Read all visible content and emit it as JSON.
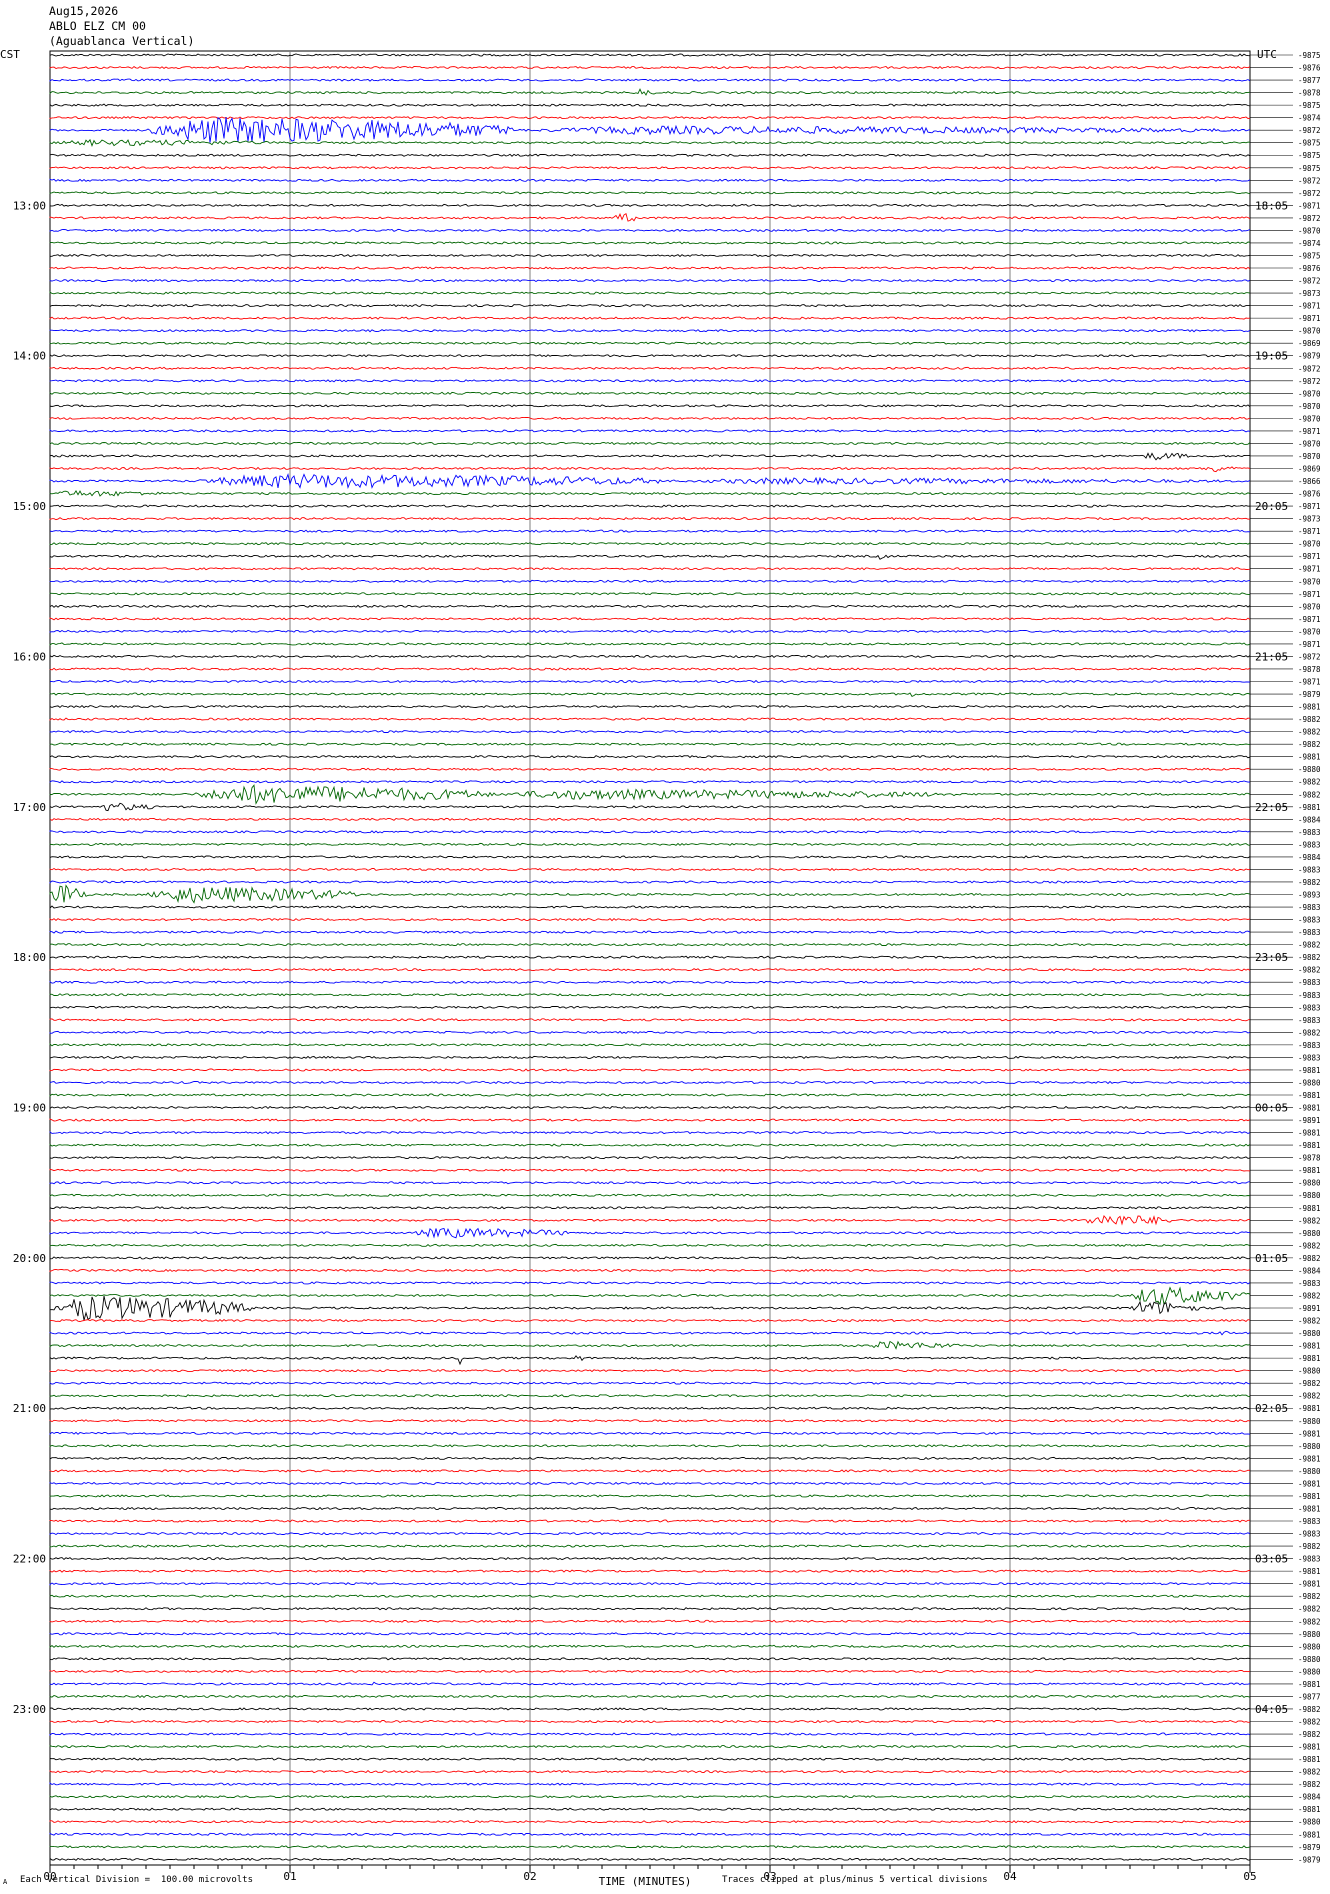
{
  "header": {
    "date": "Aug15,2026",
    "station": "ABLO ELZ CM 00",
    "location": "(Aguablanca Vertical)"
  },
  "footer": {
    "scale_marker": "A",
    "scale_note": "Each Vertical Division =  100.00 microvolts",
    "clip_note": "Traces clipped at plus/minus 5 vertical divisions"
  },
  "colors": {
    "trace_cycle": [
      "#000000",
      "#ff0000",
      "#0000ff",
      "#006400"
    ],
    "gridline": "#7f7f7f"
  },
  "chart_data": {
    "type": "helicorder",
    "left_axis_title": "CST",
    "right_axis_title": "UTC",
    "xlabel": "TIME (MINUTES)",
    "x_ticks": [
      "00",
      "01",
      "02",
      "03",
      "04",
      "05"
    ],
    "xlim": [
      0,
      5
    ],
    "rows_per_hour": 12,
    "trace_count": 145,
    "left_hour_labels": [
      {
        "row": 12,
        "label": "13:00"
      },
      {
        "row": 24,
        "label": "14:00"
      },
      {
        "row": 36,
        "label": "15:00"
      },
      {
        "row": 48,
        "label": "16:00"
      },
      {
        "row": 60,
        "label": "17:00"
      },
      {
        "row": 72,
        "label": "18:00"
      },
      {
        "row": 84,
        "label": "19:00"
      },
      {
        "row": 96,
        "label": "20:00"
      },
      {
        "row": 108,
        "label": "21:00"
      },
      {
        "row": 120,
        "label": "22:00"
      },
      {
        "row": 132,
        "label": "23:00"
      }
    ],
    "right_hour_labels": [
      {
        "row": 12,
        "label": "18:05"
      },
      {
        "row": 24,
        "label": "19:05"
      },
      {
        "row": 36,
        "label": "20:05"
      },
      {
        "row": 48,
        "label": "21:05"
      },
      {
        "row": 60,
        "label": "22:05"
      },
      {
        "row": 72,
        "label": "23:05"
      },
      {
        "row": 84,
        "label": "00:05"
      },
      {
        "row": 96,
        "label": "01:05"
      },
      {
        "row": 108,
        "label": "02:05"
      },
      {
        "row": 120,
        "label": "03:05"
      },
      {
        "row": 132,
        "label": "04:05"
      }
    ],
    "row_values": [
      -9875,
      -9876,
      -9877,
      -9878,
      -9875,
      -9874,
      -9872,
      -9875,
      -9875,
      -9875,
      -9872,
      -9872,
      -9871,
      -9872,
      -9870,
      -9874,
      -9875,
      -9876,
      -9872,
      -9873,
      -9871,
      -9871,
      -9870,
      -9869,
      -9879,
      -9872,
      -9872,
      -9870,
      -9870,
      -9870,
      -9871,
      -9870,
      -9870,
      -9869,
      -9866,
      -9876,
      -9871,
      -9873,
      -9871,
      -9870,
      -9871,
      -9871,
      -9870,
      -9871,
      -9870,
      -9871,
      -9870,
      -9871,
      -9872,
      -9878,
      -9871,
      -9879,
      -9881,
      -9882,
      -9882,
      -9882,
      -9881,
      -9880,
      -9882,
      -9882,
      -9881,
      -9884,
      -9883,
      -9883,
      -9884,
      -9883,
      -9882,
      -9893,
      -9883,
      -9883,
      -9883,
      -9882,
      -9882,
      -9882,
      -9883,
      -9883,
      -9883,
      -9883,
      -9882,
      -9883,
      -9883,
      -9881,
      -9880,
      -9881,
      -9881,
      -9891,
      -9881,
      -9881,
      -9878,
      -9881,
      -9880,
      -9880,
      -9881,
      -9882,
      -9880,
      -9882,
      -9882,
      -9884,
      -9883,
      -9882,
      -9891,
      -9882,
      -9880,
      -9881,
      -9881,
      -9880,
      -9882,
      -9882,
      -9881,
      -9880,
      -9881,
      -9880,
      -9881,
      -9880,
      -9881,
      -9881,
      -9881,
      -9883,
      -9883,
      -9882,
      -9883,
      -9881,
      -9881,
      -9882,
      -9882,
      -9882,
      -9880,
      -9880,
      -9880,
      -9880,
      -9881,
      -9877,
      -9882,
      -9882,
      -9882,
      -9881,
      -9881,
      -9882,
      -9882,
      -9884,
      -9881,
      -9880,
      -9881,
      -9879,
      -9879
    ],
    "events": [
      {
        "row": 3,
        "x0": 2.44,
        "x1": 2.52,
        "amp": 4
      },
      {
        "row": 6,
        "x0": 0.4,
        "x1": 1.95,
        "amp": 13
      },
      {
        "row": 6,
        "x0": 1.95,
        "x1": 5.0,
        "amp": 4
      },
      {
        "row": 7,
        "x0": 0.0,
        "x1": 1.0,
        "amp": 3
      },
      {
        "row": 13,
        "x0": 2.35,
        "x1": 2.45,
        "amp": 5
      },
      {
        "row": 32,
        "x0": 4.55,
        "x1": 4.75,
        "amp": 4
      },
      {
        "row": 33,
        "x0": 4.8,
        "x1": 4.95,
        "amp": 4
      },
      {
        "row": 34,
        "x0": 0.6,
        "x1": 2.6,
        "amp": 7
      },
      {
        "row": 34,
        "x0": 2.6,
        "x1": 5.0,
        "amp": 3
      },
      {
        "row": 35,
        "x0": 0.0,
        "x1": 0.5,
        "amp": 3
      },
      {
        "row": 40,
        "x0": 3.45,
        "x1": 3.5,
        "amp": 3
      },
      {
        "row": 51,
        "x0": 3.58,
        "x1": 3.62,
        "amp": 3
      },
      {
        "row": 59,
        "x0": 0.6,
        "x1": 1.85,
        "amp": 9
      },
      {
        "row": 59,
        "x0": 1.85,
        "x1": 3.8,
        "amp": 5
      },
      {
        "row": 60,
        "x0": 0.2,
        "x1": 0.45,
        "amp": 4
      },
      {
        "row": 67,
        "x0": 0.0,
        "x1": 0.15,
        "amp": 13
      },
      {
        "row": 67,
        "x0": 0.4,
        "x1": 1.3,
        "amp": 8
      },
      {
        "row": 94,
        "x0": 1.5,
        "x1": 2.2,
        "amp": 5
      },
      {
        "row": 93,
        "x0": 4.3,
        "x1": 4.7,
        "amp": 6
      },
      {
        "row": 100,
        "x0": 0.0,
        "x1": 0.85,
        "amp": 12
      },
      {
        "row": 100,
        "x0": 4.5,
        "x1": 4.8,
        "amp": 7
      },
      {
        "row": 99,
        "x0": 4.5,
        "x1": 5.0,
        "amp": 9
      },
      {
        "row": 103,
        "x0": 3.4,
        "x1": 3.8,
        "amp": 4
      },
      {
        "row": 104,
        "x0": 1.7,
        "x1": 1.73,
        "amp": 6
      },
      {
        "row": 104,
        "x0": 2.19,
        "x1": 2.22,
        "amp": 6
      },
      {
        "row": 102,
        "x0": 4.85,
        "x1": 4.92,
        "amp": 3
      },
      {
        "row": 130,
        "x0": 1.33,
        "x1": 1.37,
        "amp": 3
      }
    ]
  }
}
